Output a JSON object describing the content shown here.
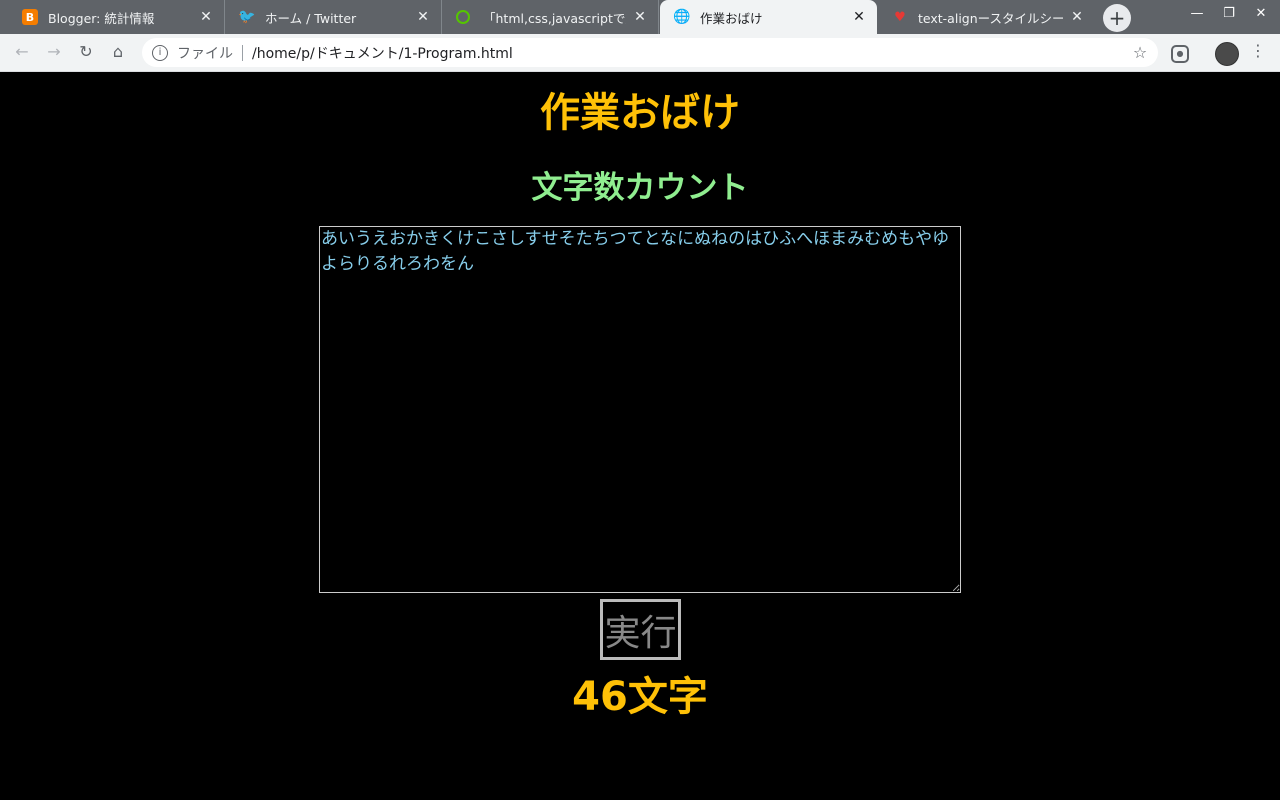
{
  "browser": {
    "tabs": [
      {
        "title": "Blogger: 統計情報",
        "icon": "blogger-icon",
        "active": false
      },
      {
        "title": "ホーム / Twitter",
        "icon": "twitter-icon",
        "active": false
      },
      {
        "title": "「html,css,javascriptで文字",
        "icon": "qiita-icon",
        "active": false
      },
      {
        "title": "作業おばけ",
        "icon": "globe-icon",
        "active": true
      },
      {
        "title": "text-alignースタイルシート",
        "icon": "heart-icon",
        "active": false
      }
    ],
    "address": {
      "scheme_label": "ファイル",
      "url": "/home/p/ドキュメント/1-Program.html"
    }
  },
  "page": {
    "site_title": "作業おばけ",
    "section_title": "文字数カウント",
    "textarea_value": "あいうえおかきくけこさしすせそたちつてとなにぬねのはひふへほまみむめもやゆよらりるれろわをん",
    "run_label": "実行",
    "result": "46文字"
  },
  "colors": {
    "site_title": "#ffc107",
    "section_title": "#90ee90",
    "textarea_text": "#87ceeb"
  }
}
